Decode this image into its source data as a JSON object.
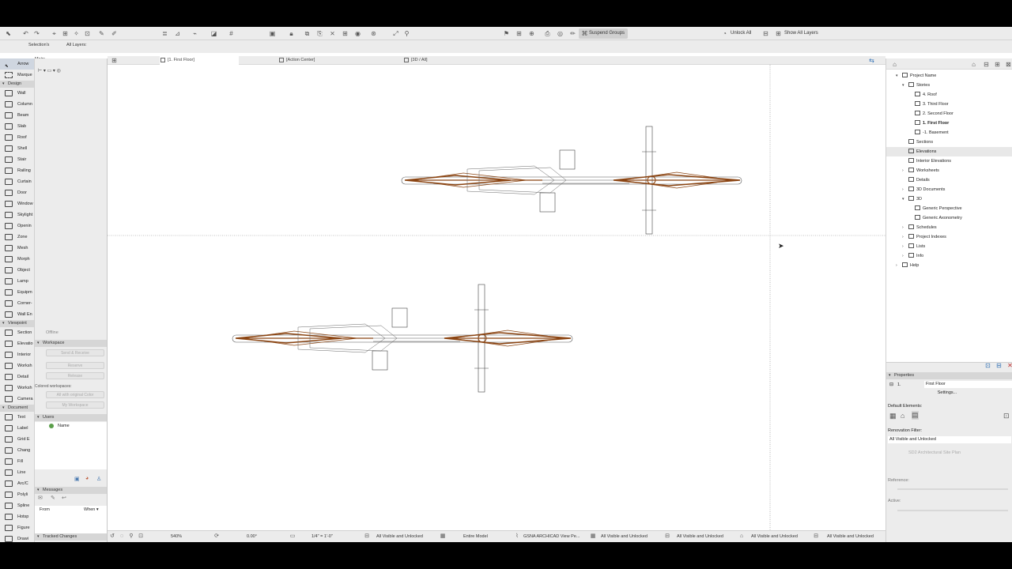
{
  "toolbar": {
    "suspend_groups": "Suspend Groups",
    "unlock_all": "Unlock All",
    "show_all_layers": "Show All Layers"
  },
  "infobar": {
    "selections": "Selection's",
    "all_layers": "All Layers:",
    "main": "Main:"
  },
  "toolbox": {
    "arrow": "Arrow",
    "marquee": "Marque",
    "sections": [
      {
        "title": "Design",
        "tools": [
          "Wall",
          "Column",
          "Beam",
          "Slab",
          "Roof",
          "Shell",
          "Stair",
          "Railing",
          "Curtain",
          "Door",
          "Window",
          "Skylight",
          "Openin",
          "Zone",
          "Mesh",
          "Morph",
          "Object",
          "Lamp",
          "Equipm",
          "Corner-",
          "Wall En"
        ]
      },
      {
        "title": "Viewpoint",
        "tools": [
          "Section",
          "Elevatio",
          "Interior",
          "Worksh",
          "Detail",
          "Worksh",
          "Camera"
        ]
      },
      {
        "title": "Document",
        "tools": [
          "Text",
          "Label",
          "Grid E",
          "Chang",
          "Fill",
          "Line",
          "Arc/C",
          "Polyli",
          "Spline",
          "Hotsp",
          "Figure",
          "Drawi"
        ]
      }
    ]
  },
  "teamwork": {
    "offline": "Offline",
    "workspace_title": "Workspace",
    "send_receive": "Send & Receive",
    "reserve": "Reserve",
    "release": "Release",
    "colored_workspaces": "Colored workspaces:",
    "all_with_original": "All with original Color",
    "my_workspace": "My Workspace",
    "users_title": "Users",
    "users_name_col": "Name",
    "messages_title": "Messages",
    "messages_from": "From",
    "messages_when": "When ▾",
    "tracked_changes": "Tracked Changes"
  },
  "tabs": [
    {
      "label": "[1. First Floor]",
      "active": true
    },
    {
      "label": "[Action Center]",
      "active": false
    },
    {
      "label": "[3D / All]",
      "active": false
    }
  ],
  "navigator": {
    "root": "Project Name",
    "stories": "Stories",
    "story_items": [
      "4. Roof",
      "3. Third Floor",
      "2. Second Floor",
      "1. First Floor",
      "-1. Basement"
    ],
    "items": [
      "Sections",
      "Elevations",
      "Interior Elevations",
      "Worksheets",
      "Details",
      "3D Documents",
      "3D"
    ],
    "items_3d": [
      "Generic Perspective",
      "Generic Axonometry"
    ],
    "more_items": [
      "Schedules",
      "Project Indexes",
      "Lists",
      "Info"
    ],
    "help": "Help"
  },
  "properties": {
    "title": "Properties",
    "story_num": "1.",
    "story_name": "First Floor",
    "settings": "Settings...",
    "default_elements": "Default Elements:",
    "renovation_filter": "Renovation Filter:",
    "renovation_value": "All Visible and Unlocked",
    "site_plan": "SD2 Architectural Site Plan",
    "reference": "Reference:",
    "active": "Active:"
  },
  "status": {
    "zoom": "540%",
    "angle": "0.00°",
    "scale": "1/4\" = 1'-0\"",
    "layer_combo": "All Visible and Unlocked",
    "model_view": "Entire Model",
    "pen_set": "GSNA ARCHICAD View Pe...",
    "filter2": "All Visible and Unlocked",
    "filter3": "All Visible and Unlocked",
    "filter4": "All Visible and Unlocked",
    "filter5": "All Visible and Unlocked"
  },
  "colors": {
    "accent": "#8b4513",
    "selection": "#cfd6e0"
  }
}
